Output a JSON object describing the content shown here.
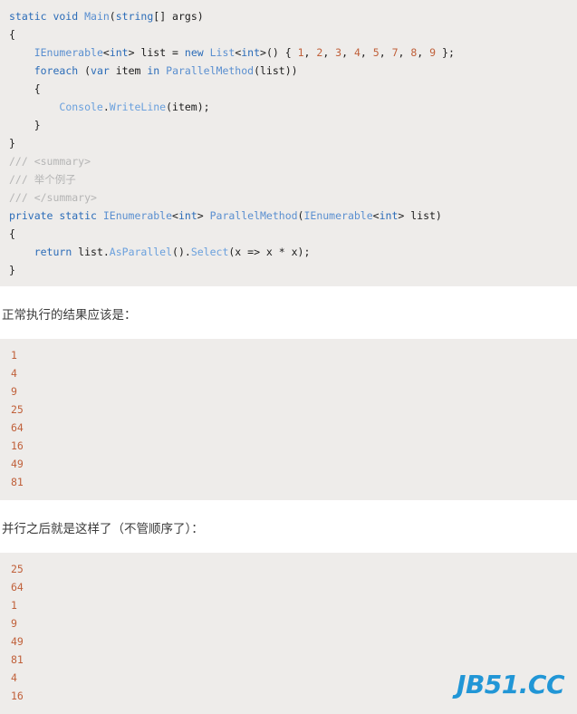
{
  "code_block_1": {
    "language": "csharp",
    "lines": [
      [
        {
          "t": "static void ",
          "c": "kw"
        },
        {
          "t": "Main",
          "c": "typ"
        },
        {
          "t": "(",
          "c": "pln"
        },
        {
          "t": "string",
          "c": "kw"
        },
        {
          "t": "[] args)",
          "c": "pln"
        }
      ],
      [
        {
          "t": "{",
          "c": "pln"
        }
      ],
      [
        {
          "t": "    ",
          "c": "pln"
        },
        {
          "t": "IEnumerable",
          "c": "typ"
        },
        {
          "t": "<",
          "c": "pln"
        },
        {
          "t": "int",
          "c": "kw"
        },
        {
          "t": "> list = ",
          "c": "pln"
        },
        {
          "t": "new ",
          "c": "kw"
        },
        {
          "t": "List",
          "c": "typ"
        },
        {
          "t": "<",
          "c": "pln"
        },
        {
          "t": "int",
          "c": "kw"
        },
        {
          "t": ">() { ",
          "c": "pln"
        },
        {
          "t": "1",
          "c": "num"
        },
        {
          "t": ", ",
          "c": "pln"
        },
        {
          "t": "2",
          "c": "num"
        },
        {
          "t": ", ",
          "c": "pln"
        },
        {
          "t": "3",
          "c": "num"
        },
        {
          "t": ", ",
          "c": "pln"
        },
        {
          "t": "4",
          "c": "num"
        },
        {
          "t": ", ",
          "c": "pln"
        },
        {
          "t": "5",
          "c": "num"
        },
        {
          "t": ", ",
          "c": "pln"
        },
        {
          "t": "7",
          "c": "num"
        },
        {
          "t": ", ",
          "c": "pln"
        },
        {
          "t": "8",
          "c": "num"
        },
        {
          "t": ", ",
          "c": "pln"
        },
        {
          "t": "9",
          "c": "num"
        },
        {
          "t": " };",
          "c": "pln"
        }
      ],
      [
        {
          "t": "    ",
          "c": "pln"
        },
        {
          "t": "foreach ",
          "c": "kw"
        },
        {
          "t": "(",
          "c": "pln"
        },
        {
          "t": "var",
          "c": "kw"
        },
        {
          "t": " item ",
          "c": "pln"
        },
        {
          "t": "in ",
          "c": "kw"
        },
        {
          "t": "ParallelMethod",
          "c": "typ"
        },
        {
          "t": "(list))",
          "c": "pln"
        }
      ],
      [
        {
          "t": "    {",
          "c": "pln"
        }
      ],
      [
        {
          "t": "        ",
          "c": "pln"
        },
        {
          "t": "Console",
          "c": "mth"
        },
        {
          "t": ".",
          "c": "pln"
        },
        {
          "t": "WriteLine",
          "c": "mth"
        },
        {
          "t": "(item);",
          "c": "pln"
        }
      ],
      [
        {
          "t": "    }",
          "c": "pln"
        }
      ],
      [
        {
          "t": "}",
          "c": "pln"
        }
      ],
      [
        {
          "t": "/// <summary>",
          "c": "cmt"
        }
      ],
      [
        {
          "t": "/// 举个例子",
          "c": "cmt"
        }
      ],
      [
        {
          "t": "/// </summary>",
          "c": "cmt"
        }
      ],
      [
        {
          "t": "private static ",
          "c": "kw"
        },
        {
          "t": "IEnumerable",
          "c": "typ"
        },
        {
          "t": "<",
          "c": "pln"
        },
        {
          "t": "int",
          "c": "kw"
        },
        {
          "t": "> ",
          "c": "pln"
        },
        {
          "t": "ParallelMethod",
          "c": "typ"
        },
        {
          "t": "(",
          "c": "pln"
        },
        {
          "t": "IEnumerable",
          "c": "typ"
        },
        {
          "t": "<",
          "c": "pln"
        },
        {
          "t": "int",
          "c": "kw"
        },
        {
          "t": "> list)",
          "c": "pln"
        }
      ],
      [
        {
          "t": "{",
          "c": "pln"
        }
      ],
      [
        {
          "t": "    ",
          "c": "pln"
        },
        {
          "t": "return ",
          "c": "kw"
        },
        {
          "t": "list.",
          "c": "pln"
        },
        {
          "t": "AsParallel",
          "c": "mth"
        },
        {
          "t": "().",
          "c": "pln"
        },
        {
          "t": "Select",
          "c": "mth"
        },
        {
          "t": "(x => x * x);",
          "c": "pln"
        }
      ],
      [
        {
          "t": "}",
          "c": "pln"
        }
      ]
    ]
  },
  "paragraph_1": "正常执行的结果应该是：",
  "output_block_1": {
    "lines": [
      "1",
      "4",
      "9",
      "25",
      "64",
      "16",
      "49",
      "81"
    ]
  },
  "paragraph_2": "并行之后就是这样了（不管顺序了）：",
  "output_block_2": {
    "lines": [
      "25",
      "64",
      "1",
      "9",
      "49",
      "81",
      "4",
      "16"
    ]
  },
  "watermark": {
    "text": "JB51.CC",
    "color": "#2196d6"
  },
  "colors": {
    "code_background": "#eeecea",
    "page_background": "#ffffff",
    "keyword": "#2b6cb8",
    "type": "#5a8fd0",
    "method": "#6aa0dd",
    "number": "#c0603a",
    "comment": "#b5b5b5",
    "plain": "#1b1b1b",
    "prose": "#3b3b3b"
  }
}
